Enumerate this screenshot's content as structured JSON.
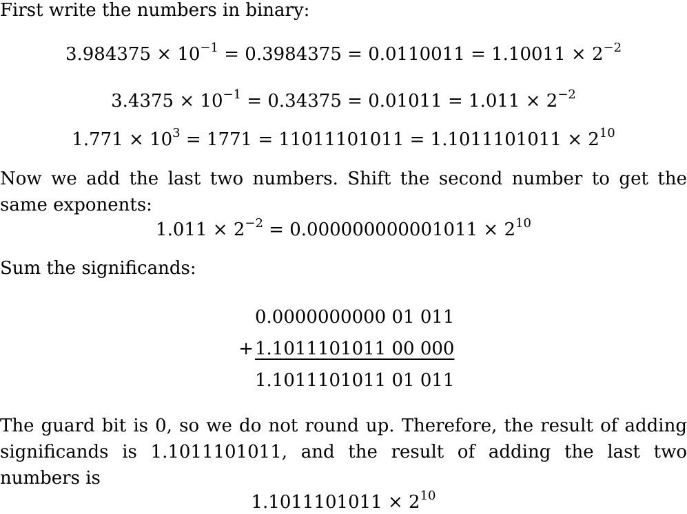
{
  "doc": {
    "intro": "First write the numbers in binary:",
    "eq1": {
      "mant": "3.984375",
      "times": "×",
      "base": "10",
      "exp": "−1",
      "rest1": " = 0.3984375 = 0.0110011 = 1.10011 ",
      "base2": "2",
      "exp2": "−2"
    },
    "eq2": {
      "mant": "3.4375",
      "times": "×",
      "base": "10",
      "exp": "−1",
      "rest1": " = 0.34375 = 0.01011 = 1.011 ",
      "base2": "2",
      "exp2": "−2"
    },
    "eq3": {
      "mant": "1.771",
      "times": "×",
      "base": "10",
      "exp": "3",
      "rest1": " = 1771 = 11011101011 = 1.1011101011 ",
      "base2": "2",
      "exp2": "10"
    },
    "para_add": "Now we add the last two numbers. Shift the second number to get the same exponents:",
    "eq4": {
      "lhs": "1.011",
      "times": "×",
      "base": "2",
      "exp": "−2",
      "rhs": " = 0.000000000001011 ",
      "base2": "2",
      "exp2": "10"
    },
    "sum_intro": "Sum the significands:",
    "sum": {
      "row1": "0.0000000000 01 011",
      "op": "+",
      "row2": "1.1011101011 00 000",
      "row3": "1.1011101011 01 011"
    },
    "para_guard": "The guard bit is 0, so we do not round up. Therefore, the result of adding significands is 1.1011101011, and the result of adding the last two numbers is",
    "final": {
      "mant": "1.1011101011",
      "times": "×",
      "base": "2",
      "exp": "10"
    }
  }
}
